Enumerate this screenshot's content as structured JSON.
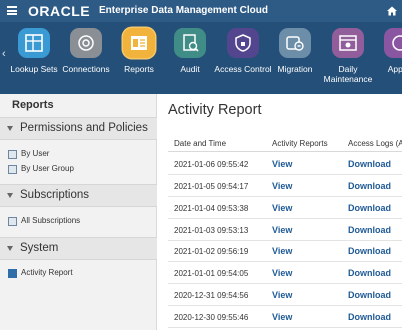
{
  "app": {
    "brand": "ORACLE",
    "title": "Enterprise Data Management Cloud"
  },
  "nav": {
    "items": [
      {
        "label": "Lookup Sets",
        "icon": "lookup-sets-icon",
        "color": "#3a9ad4"
      },
      {
        "label": "Connections",
        "icon": "connections-icon",
        "color": "#8a8f95"
      },
      {
        "label": "Reports",
        "icon": "reports-icon",
        "color": "#f2b33d"
      },
      {
        "label": "Audit",
        "icon": "audit-icon",
        "color": "#3f8d86"
      },
      {
        "label": "Access Control",
        "icon": "access-control-icon",
        "color": "#53468f"
      },
      {
        "label": "Migration",
        "icon": "migration-icon",
        "color": "#6c8ea8"
      },
      {
        "label": "Daily Maintenance",
        "icon": "daily-maintenance-icon",
        "color": "#915e9b"
      },
      {
        "label": "Appea",
        "icon": "appearance-icon",
        "color": "#8a56a2"
      }
    ],
    "active": "Reports"
  },
  "sidebar": {
    "title": "Reports",
    "sections": [
      {
        "label": "Permissions and Policies",
        "items": [
          "By User",
          "By User Group"
        ]
      },
      {
        "label": "Subscriptions",
        "items": [
          "All Subscriptions"
        ]
      },
      {
        "label": "System",
        "items": [
          "Activity Report"
        ]
      }
    ],
    "active_item": "Activity Report"
  },
  "main": {
    "title": "Activity Report",
    "columns": [
      "Date and Time",
      "Activity Reports",
      "Access Logs (A"
    ],
    "rows": [
      {
        "date": "2021-01-06 09:55:42",
        "view": "View",
        "download": "Download"
      },
      {
        "date": "2021-01-05 09:54:17",
        "view": "View",
        "download": "Download"
      },
      {
        "date": "2021-01-04 09:53:38",
        "view": "View",
        "download": "Download"
      },
      {
        "date": "2021-01-03 09:53:13",
        "view": "View",
        "download": "Download"
      },
      {
        "date": "2021-01-02 09:56:19",
        "view": "View",
        "download": "Download"
      },
      {
        "date": "2021-01-01 09:54:05",
        "view": "View",
        "download": "Download"
      },
      {
        "date": "2020-12-31 09:54:56",
        "view": "View",
        "download": "Download"
      },
      {
        "date": "2020-12-30 09:55:46",
        "view": "View",
        "download": "Download"
      }
    ]
  },
  "colors": {
    "topbar": "#2e5b86",
    "navstrip": "#244f78",
    "link": "#1f5a96"
  }
}
